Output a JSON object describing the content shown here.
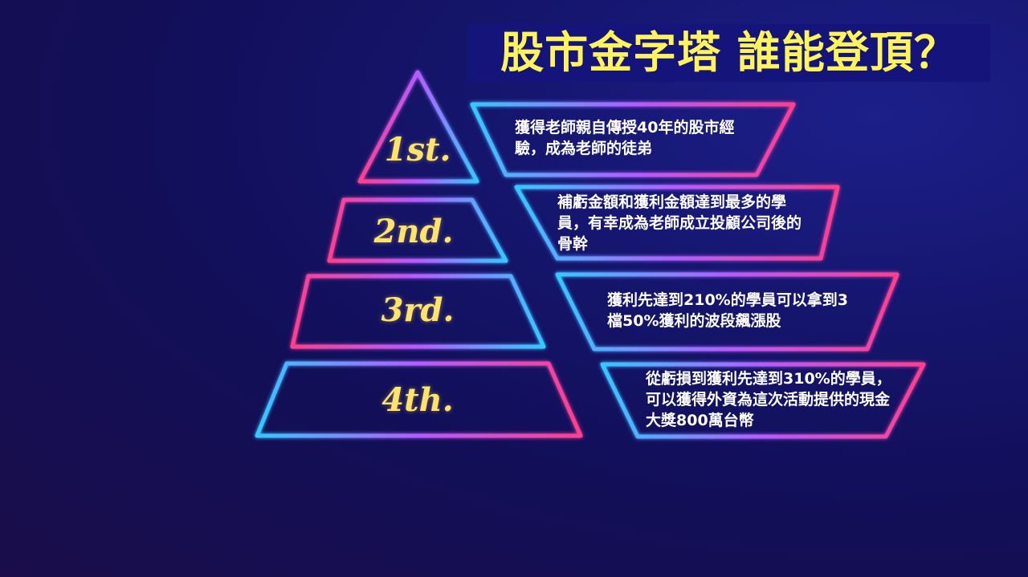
{
  "title": "股市金字塔 誰能登頂？",
  "colors": {
    "accent_pink": "#ff3f8f",
    "accent_cyan": "#35c8ff",
    "accent_purple": "#b45cff",
    "label_yellow": "#ffe36a"
  },
  "tiers": [
    {
      "rank": "1st.",
      "desc": "獲得老師親自傳授40年的股市經驗，成為老師的徒弟"
    },
    {
      "rank": "2nd.",
      "desc": "補虧金額和獲利金額達到最多的學員，有幸成為老師成立投顧公司後的骨幹"
    },
    {
      "rank": "3rd.",
      "desc": "獲利先達到210%的學員可以拿到3檔50%獲利的波段飆漲股"
    },
    {
      "rank": "4th.",
      "desc": "從虧損到獲利先達到310%的學員，可以獲得外資為這次活動提供的現金大獎800萬台幣"
    }
  ]
}
